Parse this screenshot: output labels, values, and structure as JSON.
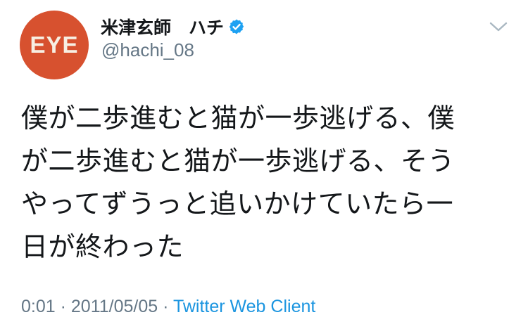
{
  "author": {
    "avatar_text": "EYE",
    "display_name": "米津玄師　ハチ",
    "handle": "@hachi_08",
    "verified": true
  },
  "tweet": {
    "lines": [
      "僕が二歩進むと猫が一歩逃げる、僕",
      "が二歩進むと猫が一歩逃げる、そう",
      "やってずうっと追いかけていたら一",
      "日が終わった"
    ]
  },
  "meta": {
    "time": "0:01",
    "separator": " · ",
    "date": "2011/05/05",
    "source": "Twitter Web Client"
  },
  "icons": {
    "verified": "verified-badge-icon",
    "menu": "chevron-down-icon"
  },
  "colors": {
    "avatar_bg": "#d7512f",
    "link": "#1b95e0",
    "secondary_text": "#657786",
    "verified": "#1da1f2"
  }
}
